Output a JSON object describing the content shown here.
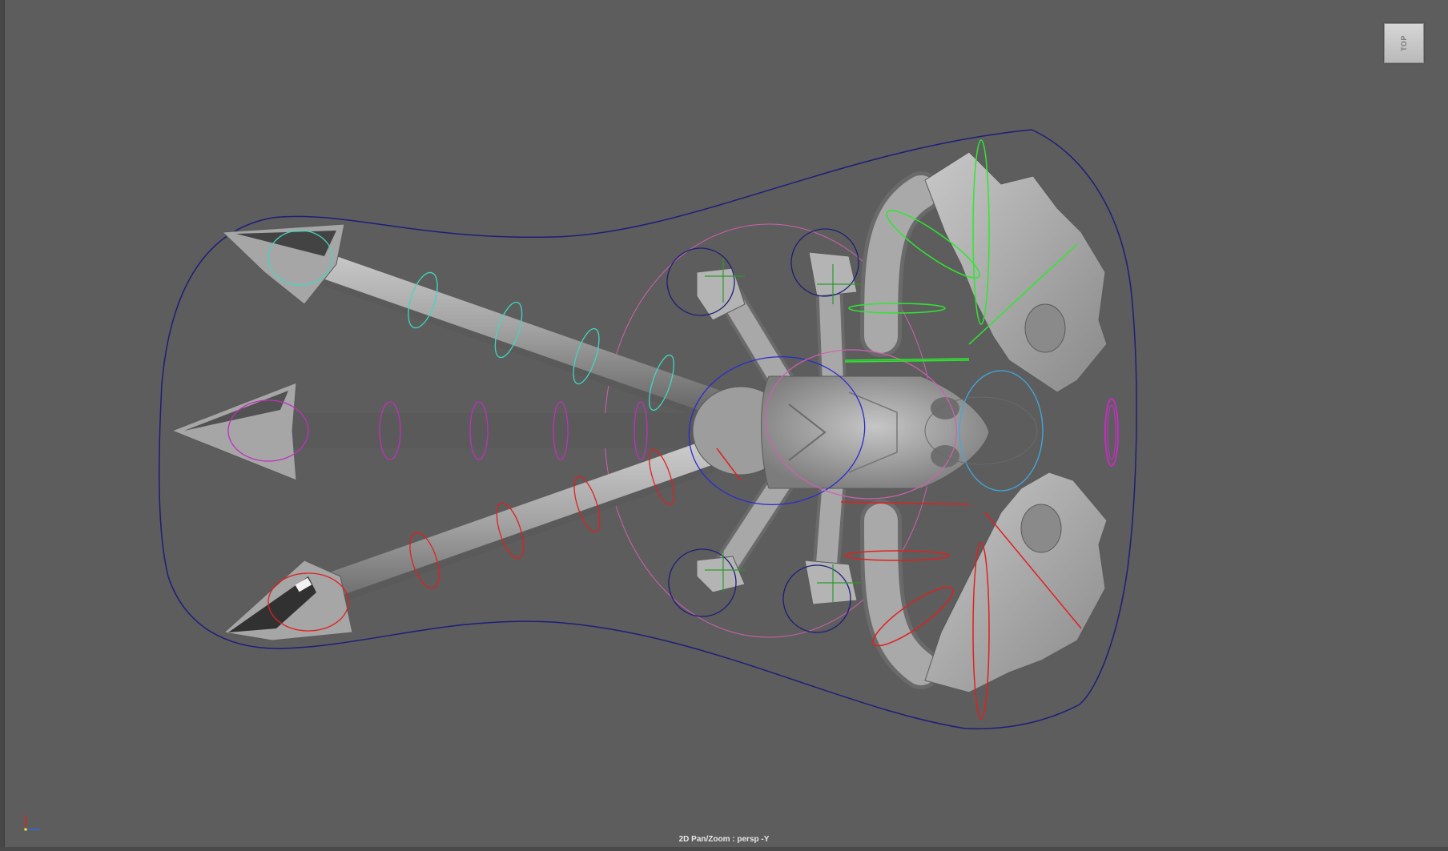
{
  "viewport": {
    "view_cube_label": "TOP",
    "status_text": "2D Pan/Zoom : persp -Y"
  },
  "colors": {
    "background": "#5d5d5d",
    "mesh": "#a8a8a8",
    "control_outer": "#1d1d7a",
    "control_cog": "#d060b0",
    "control_body": "#2a2ad0",
    "control_left": "#2ee82e",
    "control_right": "#e02020",
    "control_tail_top": "#40d8c0",
    "control_tail_mid": "#c030c0",
    "control_head": "#40a8e0"
  },
  "icons": {
    "axis": "axis-indicator-icon"
  }
}
